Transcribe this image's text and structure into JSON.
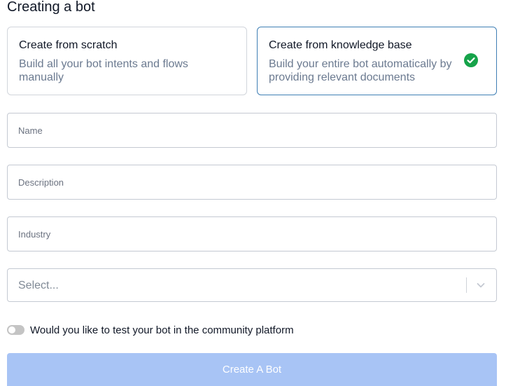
{
  "page": {
    "title": "Creating a bot"
  },
  "options": [
    {
      "title": "Create from scratch",
      "description": "Build all your bot intents and flows manually",
      "selected": false
    },
    {
      "title": "Create from knowledge base",
      "description": "Build your entire bot automatically by providing relevant documents",
      "selected": true,
      "icon": "check-circle-icon"
    }
  ],
  "form": {
    "name_placeholder": "Name",
    "description_placeholder": "Description",
    "industry_placeholder": "Industry",
    "select_value": "Select...",
    "select_icon": "chevron-down-icon",
    "toggle_label": "Would you like to test your bot in the community platform",
    "toggle_on": false,
    "submit_label": "Create A Bot"
  },
  "colors": {
    "selected_border": "#3f7fb5",
    "check": "#16a34a",
    "button_disabled": "#a8c4f5"
  }
}
